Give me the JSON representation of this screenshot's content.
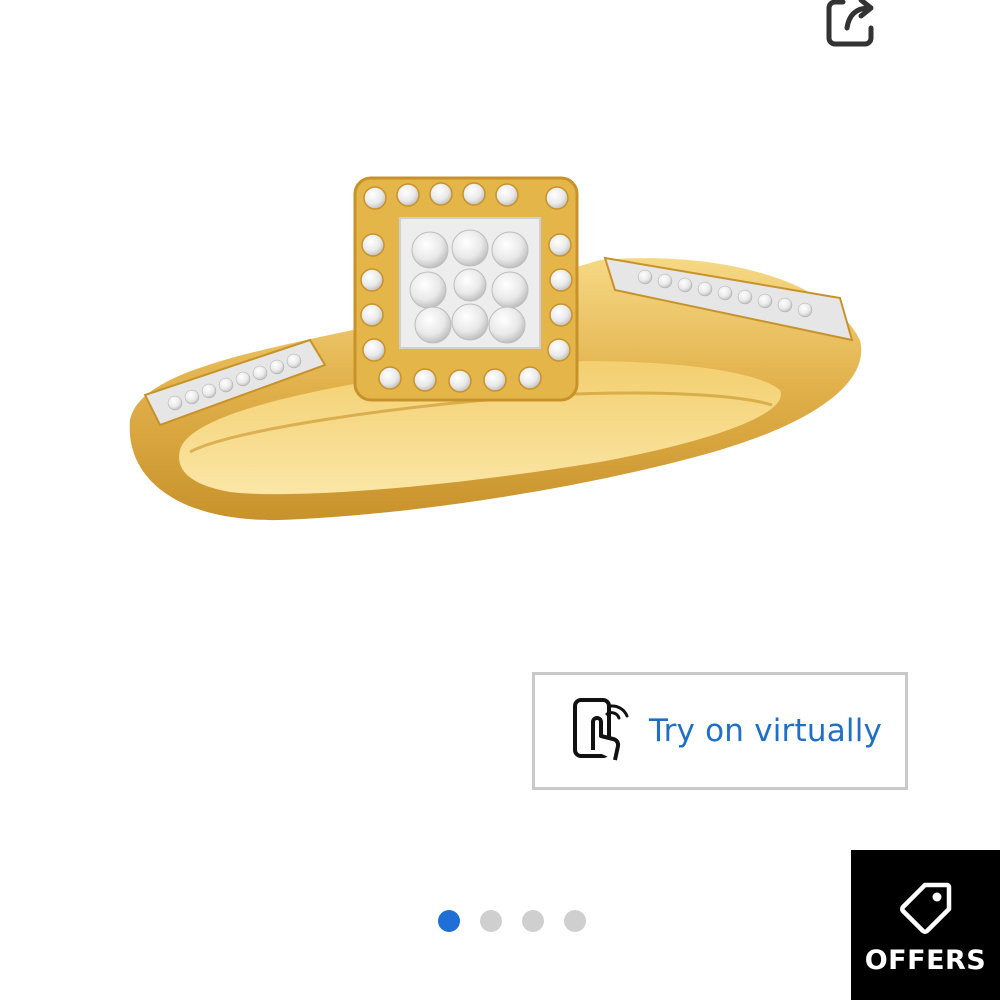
{
  "header": {
    "share_icon": "share-icon"
  },
  "product": {
    "image_icon": "gold-halo-diamond-ring",
    "colors": {
      "gold": "#e4b548",
      "diamond": "#f4f4f4"
    }
  },
  "try_on": {
    "label": "Try on virtually",
    "icon": "phone-touch-icon",
    "accent": "#1f6fc8"
  },
  "carousel": {
    "total": 4,
    "active": 1,
    "active_color": "#1f6fd6",
    "inactive_color": "#cfcfcf"
  },
  "offers": {
    "label": "OFFERS",
    "icon": "tag-icon"
  }
}
